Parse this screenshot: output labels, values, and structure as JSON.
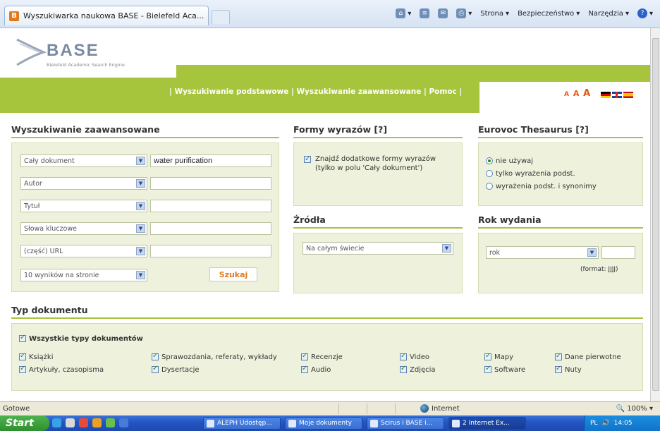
{
  "browser": {
    "tab_title": "Wyszukiwarka naukowa BASE - Bielefeld Aca...",
    "tab_favicon": "B",
    "commands": {
      "page": "Strona",
      "security": "Bezpieczeństwo",
      "tools": "Narzędzia"
    }
  },
  "header": {
    "logo_text": "BASE",
    "logo_subtitle": "Bielefeld Academic Search Engine",
    "nav": "| Wyszukiwanie podstawowe | Wyszukiwanie zaawansowane | Pomoc |",
    "font_sizes": [
      "A",
      "A",
      "A"
    ],
    "languages": [
      "de-flag",
      "gb-flag",
      "es-flag"
    ]
  },
  "advanced": {
    "title": "Wyszukiwanie zaawansowane",
    "rows": [
      {
        "field": "Cały dokument",
        "value": "water purification"
      },
      {
        "field": "Autor",
        "value": ""
      },
      {
        "field": "Tytuł",
        "value": ""
      },
      {
        "field": "Słowa kluczowe",
        "value": ""
      },
      {
        "field": "(część) URL",
        "value": ""
      }
    ],
    "per_page": "10 wyników na stronie",
    "search_button": "Szukaj"
  },
  "forms": {
    "title": "Formy wyrazów [?]",
    "option": "Znajdź dodatkowe formy wyrazów (tylko w polu 'Cały dokument')"
  },
  "sources": {
    "title": "Źródła",
    "select": "Na całym świecie"
  },
  "eurovoc": {
    "title": "Eurovoc Thesaurus [?]",
    "options": [
      "nie używaj",
      "tylko wyrażenia podst.",
      "wyrażenia podst. i synonimy"
    ]
  },
  "year": {
    "title": "Rok wydania",
    "select": "rok",
    "hint": "(format: JJJJ)"
  },
  "doctype": {
    "title": "Typ dokumentu",
    "all": "Wszystkie typy dokumentów",
    "items": [
      "Książki",
      "Artykuły, czasopisma",
      "Sprawozdania, referaty, wykłady",
      "Dysertacje",
      "Recenzje",
      "Audio",
      "Video",
      "Zdjęcia",
      "Mapy",
      "Software",
      "Dane pierwotne",
      "Nuty"
    ]
  },
  "status": {
    "text": "Gotowe",
    "zone": "Internet",
    "zoom": "100%"
  },
  "taskbar": {
    "start": "Start",
    "tasks": [
      "ALEPH Udostęp...",
      "Moje dokumenty",
      "Scirus i BASE i...",
      "2 Internet Ex..."
    ],
    "lang": "PL",
    "clock": "14:05"
  }
}
